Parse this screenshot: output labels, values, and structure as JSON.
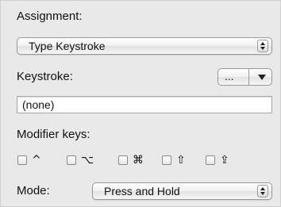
{
  "assignment": {
    "label": "Assignment:",
    "selected": "Type Keystroke"
  },
  "keystroke": {
    "label": "Keystroke:",
    "menu_label": "...",
    "value": "(none)"
  },
  "modifiers": {
    "label": "Modifier keys:",
    "keys": [
      {
        "symbol": "^",
        "checked": false
      },
      {
        "symbol": "⌥",
        "checked": false
      },
      {
        "symbol": "⌘",
        "checked": false
      },
      {
        "symbol": "⇧",
        "checked": false
      },
      {
        "symbol": "⇪",
        "checked": false
      }
    ]
  },
  "mode": {
    "label": "Mode:",
    "selected": "Press and Hold"
  }
}
